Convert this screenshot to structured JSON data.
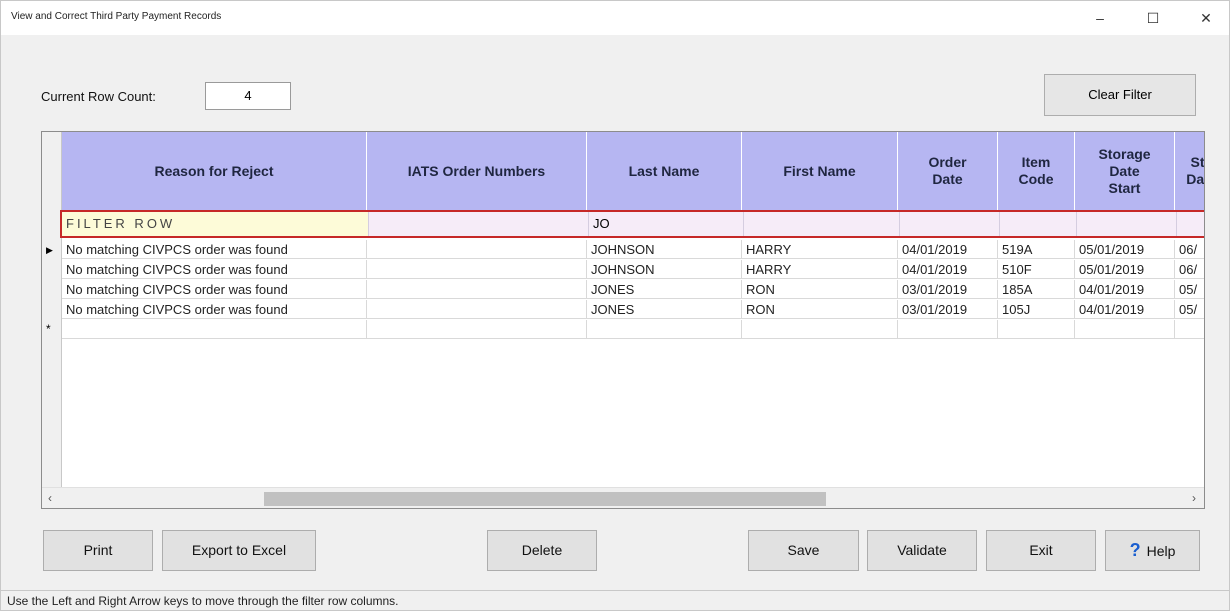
{
  "window": {
    "title": "View and Correct Third Party Payment Records",
    "minimize_glyph": "–",
    "maximize_glyph": "☐",
    "close_glyph": "✕"
  },
  "row_count": {
    "label": "Current Row Count:",
    "value": "4"
  },
  "clear_filter_label": "Clear Filter",
  "grid": {
    "columns": [
      "Reason for Reject",
      "IATS Order Numbers",
      "Last Name",
      "First Name",
      "Order Date",
      "Item Code",
      "Storage Date Start",
      "St Dat"
    ],
    "filter_row": {
      "label": "FILTER ROW",
      "last_name_filter": "JO"
    },
    "rows": [
      {
        "reason": "No matching CIVPCS order was found",
        "iats": "",
        "last_name": "JOHNSON",
        "first_name": "HARRY",
        "order_date": "04/01/2019",
        "item_code": "519A",
        "storage_start": "05/01/2019",
        "storage_end": "06/"
      },
      {
        "reason": "No matching CIVPCS order was found",
        "iats": "",
        "last_name": "JOHNSON",
        "first_name": "HARRY",
        "order_date": "04/01/2019",
        "item_code": "510F",
        "storage_start": "05/01/2019",
        "storage_end": "06/"
      },
      {
        "reason": "No matching CIVPCS order was found",
        "iats": "",
        "last_name": "JONES",
        "first_name": "RON",
        "order_date": "03/01/2019",
        "item_code": "185A",
        "storage_start": "04/01/2019",
        "storage_end": "05/"
      },
      {
        "reason": "No matching CIVPCS order was found",
        "iats": "",
        "last_name": "JONES",
        "first_name": "RON",
        "order_date": "03/01/2019",
        "item_code": "105J",
        "storage_start": "04/01/2019",
        "storage_end": "05/"
      }
    ],
    "current_row_marker": "▶",
    "new_row_marker": "*",
    "scroll_left": "‹",
    "scroll_right": "›"
  },
  "buttons": {
    "print": "Print",
    "export": "Export to Excel",
    "delete": "Delete",
    "save": "Save",
    "validate": "Validate",
    "exit": "Exit",
    "help": "Help",
    "help_icon": "?"
  },
  "status_text": "Use the Left and Right Arrow keys to move through the filter row columns."
}
